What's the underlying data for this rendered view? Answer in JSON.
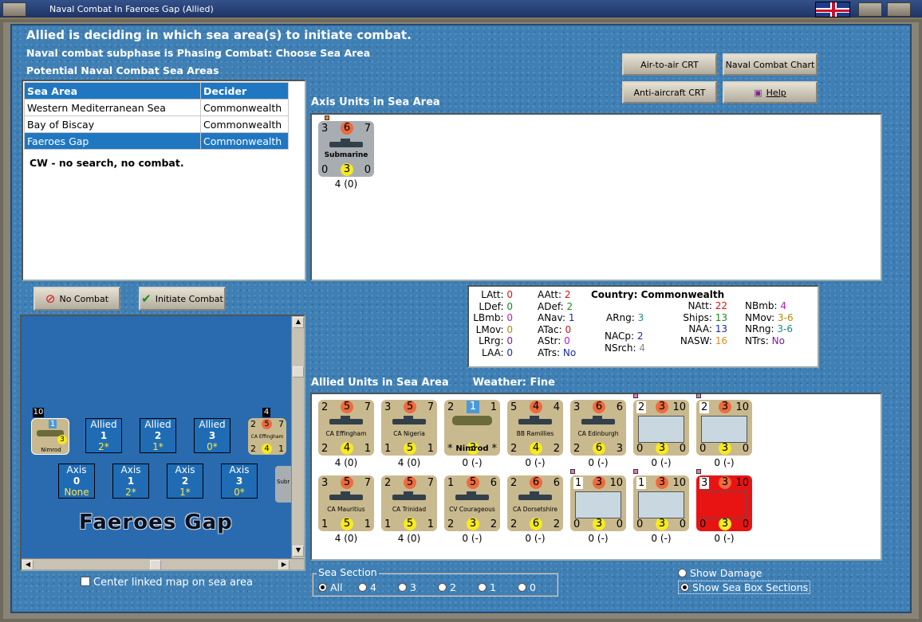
{
  "window": {
    "title": "Naval Combat In Faeroes Gap (Allied)"
  },
  "header": {
    "line1": "Allied is deciding in which sea area(s) to initiate combat.",
    "line2": "Naval combat subphase is Phasing Combat: Choose Sea Area",
    "line3": "Potential Naval Combat Sea Areas"
  },
  "buttons": {
    "air_to_air": "Air-to-air CRT",
    "naval_chart": "Naval Combat Chart",
    "anti_aircraft": "Anti-aircraft CRT",
    "help": "Help",
    "no_combat": "No Combat",
    "initiate": "Initiate Combat"
  },
  "sea_table": {
    "col1": "Sea Area",
    "col2": "Decider",
    "rows": [
      {
        "area": "Western Mediterranean Sea",
        "decider": "Commonwealth"
      },
      {
        "area": "Bay of Biscay",
        "decider": "Commonwealth"
      },
      {
        "area": "Faeroes Gap",
        "decider": "Commonwealth"
      }
    ],
    "note": "CW - no search, no combat."
  },
  "axis_section": {
    "title": "Axis Units in Sea Area",
    "units": [
      {
        "tl": "3",
        "tm": "6",
        "tr": "7",
        "name": "Submarine",
        "bl": "0",
        "bm": "3",
        "br": "0",
        "under": "4 (0)"
      }
    ]
  },
  "stats": {
    "country_label": "Country:",
    "country": "Commonwealth",
    "c1": [
      [
        "LAtt:",
        "0"
      ],
      [
        "LDef:",
        "0"
      ],
      [
        "LBmb:",
        "0"
      ],
      [
        "LMov:",
        "0"
      ],
      [
        "LRrg:",
        "0"
      ],
      [
        "LAA:",
        "0"
      ]
    ],
    "c2": [
      [
        "AAtt:",
        "2"
      ],
      [
        "ADef:",
        "2"
      ],
      [
        "ANav:",
        "1"
      ],
      [
        "ATac:",
        "0"
      ],
      [
        "AStr:",
        "0"
      ],
      [
        "ATrs:",
        "No"
      ]
    ],
    "c3": [
      [
        "ARng:",
        "3"
      ],
      [
        "NACp:",
        "2"
      ],
      [
        "NSrch:",
        "4"
      ]
    ],
    "c4": [
      [
        "NAtt:",
        "22"
      ],
      [
        "Ships:",
        "13"
      ],
      [
        "NAA:",
        "13"
      ],
      [
        "NASW:",
        "16"
      ]
    ],
    "c5": [
      [
        "NBmb:",
        "4"
      ],
      [
        "NMov:",
        "3-6"
      ],
      [
        "NRng:",
        "3-6"
      ],
      [
        "NTrs:",
        "No"
      ]
    ]
  },
  "allied_section": {
    "title": "Allied Units in Sea Area",
    "weather_label": "Weather:",
    "weather": "Fine",
    "row1": [
      {
        "tl": "2",
        "tm": "5",
        "tr": "7",
        "name": "CA Effingham",
        "bl": "2",
        "bm": "4",
        "br": "1",
        "under": "4 (0)"
      },
      {
        "tl": "3",
        "tm": "5",
        "tr": "7",
        "name": "CA Nigeria",
        "bl": "1",
        "bm": "5",
        "br": "1",
        "under": "4 (0)"
      },
      {
        "tl": "2",
        "tm": "1",
        "tr": "1",
        "name": "Nimrod",
        "bl": "*",
        "bm": "3",
        "br": "*",
        "under": "0 (-)"
      },
      {
        "tl": "5",
        "tm": "4",
        "tr": "4",
        "name": "BB Ramillies",
        "bl": "2",
        "bm": "4",
        "br": "2",
        "under": "0 (-)"
      },
      {
        "tl": "3",
        "tm": "6",
        "tr": "6",
        "name": "CA Edinburgh",
        "bl": "2",
        "bm": "6",
        "br": "3",
        "under": "0 (-)"
      },
      {
        "tl": "2",
        "tm": "3",
        "tr": "10",
        "name": "",
        "bl": "0",
        "bm": "3",
        "br": "0",
        "under": "0 (-)"
      },
      {
        "tl": "2",
        "tm": "3",
        "tr": "10",
        "name": "",
        "bl": "0",
        "bm": "3",
        "br": "0",
        "under": "0 (-)"
      }
    ],
    "row2": [
      {
        "tl": "3",
        "tm": "5",
        "tr": "7",
        "name": "CA Mauritius",
        "bl": "1",
        "bm": "5",
        "br": "1",
        "under": "4 (0)"
      },
      {
        "tl": "2",
        "tm": "5",
        "tr": "7",
        "name": "CA Trinidad",
        "bl": "1",
        "bm": "5",
        "br": "1",
        "under": "4 (0)"
      },
      {
        "tl": "1",
        "tm": "5",
        "tr": "6",
        "name": "CV Courageous",
        "bl": "2",
        "bm": "3",
        "br": "2",
        "under": "0 (-)"
      },
      {
        "tl": "2",
        "tm": "6",
        "tr": "6",
        "name": "CA Dorsetshire",
        "bl": "2",
        "bm": "6",
        "br": "2",
        "under": "0 (-)"
      },
      {
        "tl": "1",
        "tm": "3",
        "tr": "10",
        "name": "",
        "bl": "0",
        "bm": "3",
        "br": "0",
        "under": "0 (-)"
      },
      {
        "tl": "1",
        "tm": "3",
        "tr": "10",
        "name": "",
        "bl": "0",
        "bm": "3",
        "br": "0",
        "under": "0 (-)"
      },
      {
        "tl": "3",
        "tm": "3",
        "tr": "10",
        "name": "",
        "bl": "0",
        "bm": "3",
        "br": "0",
        "under": "0 (-)"
      }
    ]
  },
  "map": {
    "title": "Faeroes Gap",
    "left_stack": "10",
    "left_unit": {
      "tm": "1",
      "br": "3",
      "name": "Nimrod"
    },
    "right_stack": "4",
    "right_unit": {
      "tl": "2",
      "tm": "5",
      "tr": "7",
      "name": "CA Effingham",
      "bl": "2",
      "bm": "4",
      "br": "1"
    },
    "allied_boxes": [
      {
        "label": "Allied",
        "num": "1",
        "val": "2*"
      },
      {
        "label": "Allied",
        "num": "2",
        "val": "1*"
      },
      {
        "label": "Allied",
        "num": "3",
        "val": "0*"
      }
    ],
    "axis_boxes": [
      {
        "label": "Axis",
        "num": "0",
        "val": "None"
      },
      {
        "label": "Axis",
        "num": "1",
        "val": "2*"
      },
      {
        "label": "Axis",
        "num": "2",
        "val": "1*"
      },
      {
        "label": "Axis",
        "num": "3",
        "val": "0*"
      }
    ],
    "partial_unit": "Subr"
  },
  "footer": {
    "center_map": "Center linked map on sea area",
    "sea_section_label": "Sea Section",
    "sections": [
      "All",
      "4",
      "3",
      "2",
      "1",
      "0"
    ],
    "show_damage": "Show Damage",
    "show_sections": "Show Sea Box Sections"
  },
  "colors": {
    "accent": "#1f77c2",
    "sea": "#3f7fb4",
    "counter": "#c9b98e",
    "attack_circle": "#ec6b3f",
    "defense_circle": "#f6ea20",
    "damaged": "#e81414"
  }
}
